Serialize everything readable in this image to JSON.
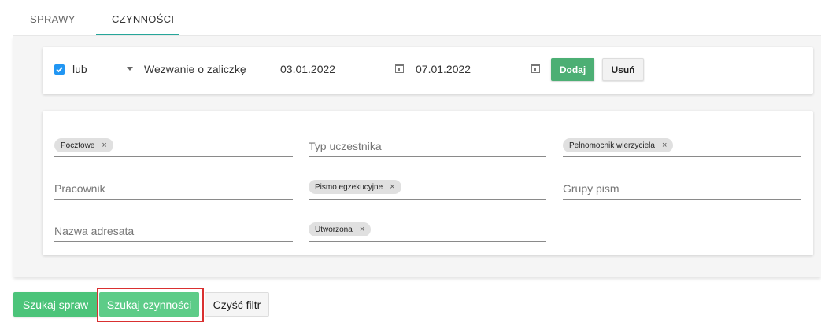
{
  "tabs": [
    {
      "label": "SPRAWY"
    },
    {
      "label": "CZYNNOŚCI",
      "active": true
    }
  ],
  "top_filter": {
    "checked": true,
    "operator": "lub",
    "activity_value": "Wezwanie o zaliczkę",
    "date_from": "03.01.2022",
    "date_to": "07.01.2022",
    "add_label": "Dodaj",
    "remove_label": "Usuń"
  },
  "filters": {
    "shipping_chip": "Pocztowe",
    "participant_type_placeholder": "Typ uczestnika",
    "representative_chip": "Pełnomocnik wierzyciela",
    "employee_placeholder": "Pracownik",
    "document_chip": "Pismo egzekucyjne",
    "doc_groups_placeholder": "Grupy pism",
    "recipient_placeholder": "Nazwa adresata",
    "status_chip": "Utworzona",
    "chip_remove": "×"
  },
  "actions": {
    "search_cases": "Szukaj spraw",
    "search_activities": "Szukaj czynności",
    "clear_filter": "Czyść filtr"
  },
  "colors": {
    "accent_green": "#4caf74",
    "tab_indicator": "#26a69a",
    "checkbox_blue": "#2196f3",
    "highlight_red": "#d93030"
  }
}
